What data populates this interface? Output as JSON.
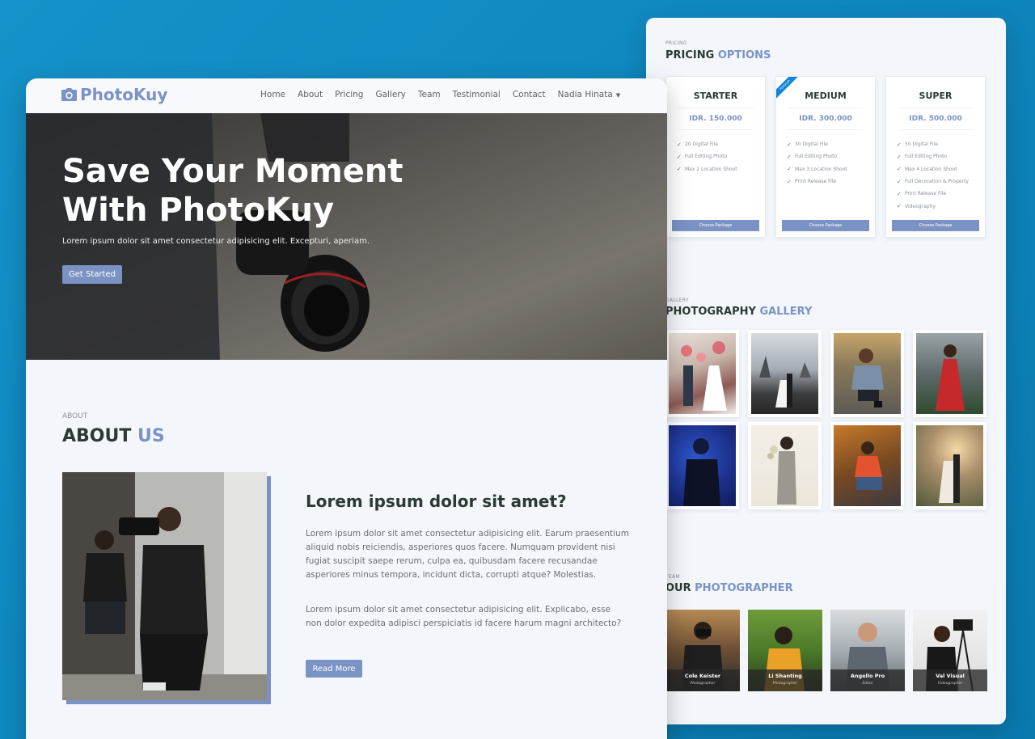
{
  "main": {
    "brand": "PhotoKuy",
    "nav": {
      "home": "Home",
      "about": "About",
      "pricing": "Pricing",
      "gallery": "Gallery",
      "team": "Team",
      "testimonial": "Testimonial",
      "contact": "Contact",
      "user": "Nadia Hinata"
    },
    "hero": {
      "title": "Save Your Moment With PhotoKuy",
      "subtitle": "Lorem ipsum dolor sit amet consectetur adipisicing elit. Excepturi, aperiam.",
      "button": "Get Started"
    },
    "about": {
      "eyebrow": "ABOUT",
      "heading_main": "ABOUT",
      "heading_accent": "US",
      "question": "Lorem ipsum dolor sit amet?",
      "paragraph1": "Lorem ipsum dolor sit amet consectetur adipisicing elit. Earum praesentium aliquid nobis reiciendis, asperiores quos facere. Numquam provident nisi fugiat suscipit saepe rerum, culpa ea, quibusdam facere recusandae asperiores minus tempora, incidunt dicta, corrupti atque? Molestias.",
      "paragraph2": "Lorem ipsum dolor sit amet consectetur adipisicing elit. Explicabo, esse non dolor expedita adipisci perspiciatis id facere harum magni architecto?",
      "button": "Read More"
    }
  },
  "pricing": {
    "eyebrow": "PRICING",
    "heading_main": "PRICING",
    "heading_accent": "OPTIONS",
    "ribbon": "POPULAR",
    "plans": [
      {
        "name": "STARTER",
        "price": "IDR. 150.000",
        "features": [
          "20 Digital File",
          "Full Editing Photo",
          "Max 2 Location Shoot"
        ],
        "button": "Choose Package"
      },
      {
        "name": "MEDIUM",
        "price": "IDR. 300.000",
        "features": [
          "30 Digital File",
          "Full Editing Photo",
          "Max 3 Location Shoot",
          "Print Release File"
        ],
        "button": "Choose Package"
      },
      {
        "name": "SUPER",
        "price": "IDR. 500.000",
        "features": [
          "50 Digital File",
          "Full Editing Photo",
          "Max 4 Location Shoot",
          "Full Decoration & Property",
          "Print Release File",
          "Videography"
        ],
        "button": "Choose Package"
      }
    ]
  },
  "gallery": {
    "eyebrow": "GALLERY",
    "heading_main": "PHOTOGRAPHY",
    "heading_accent": "GALLERY"
  },
  "team": {
    "eyebrow": "TEAM",
    "heading_main": "OUR",
    "heading_accent": "PHOTOGRAPHER",
    "members": [
      {
        "name": "Cole Keister",
        "role": "Photographer"
      },
      {
        "name": "Li Shanting",
        "role": "Photographer"
      },
      {
        "name": "Angello Pro",
        "role": "Editor"
      },
      {
        "name": "Val Visual",
        "role": "Videographer"
      }
    ]
  },
  "colors": {
    "accent": "#7b93c4",
    "dark_text": "#2c3a33",
    "background": "#1592c9",
    "ribbon": "#0d84d8"
  }
}
